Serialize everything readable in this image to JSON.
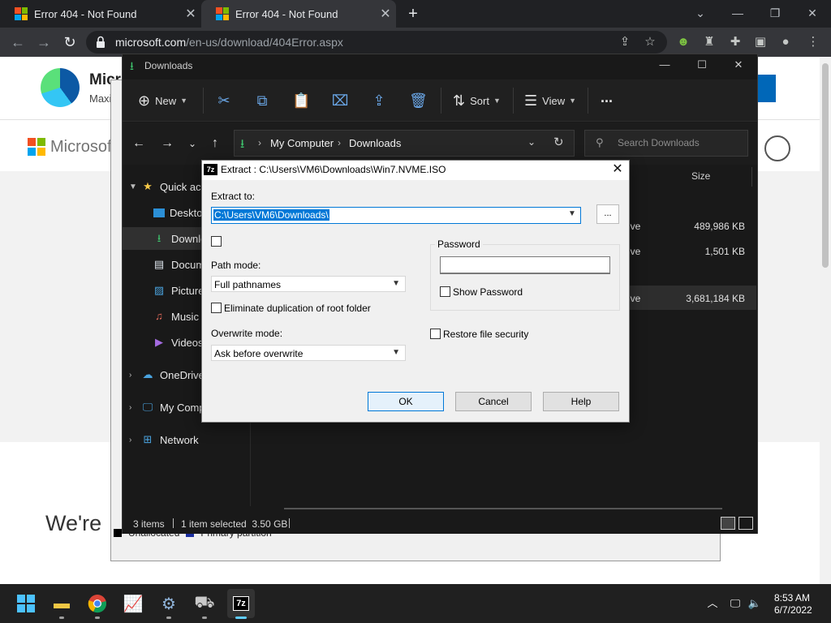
{
  "browser": {
    "tabs": [
      {
        "title": "Error 404 - Not Found",
        "active": false
      },
      {
        "title": "Error 404 - Not Found",
        "active": true
      }
    ],
    "url_host": "microsoft.com",
    "url_path": "/en-us/download/404Error.aspx",
    "colors": {
      "frame": "#202124",
      "toolbar": "#35363a"
    }
  },
  "page": {
    "brand_partial": "Micr",
    "sub_partial": "Maxi",
    "logo_text": "Microsof",
    "heading_partial": "We're"
  },
  "disk_mgmt": {
    "legend_unallocated": "Unallocated",
    "legend_primary": "Primary partition"
  },
  "explorer": {
    "title": "Downloads",
    "toolbar": {
      "new_label": "New",
      "sort_label": "Sort",
      "view_label": "View",
      "more_label": "..."
    },
    "breadcrumb": [
      "My Computer",
      "Downloads"
    ],
    "search_placeholder": "Search Downloads",
    "nav": {
      "quick_access": "Quick access",
      "desktop": "Desktop",
      "downloads": "Downloads",
      "documents": "Documents",
      "pictures": "Pictures",
      "music": "Music",
      "videos": "Videos",
      "onedrive": "OneDrive",
      "my_computer": "My Computer",
      "network": "Network"
    },
    "columns": {
      "size": "Size"
    },
    "files": [
      {
        "type_partial": "ive",
        "size": "489,986 KB",
        "selected": false
      },
      {
        "type_partial": "ive",
        "size": "1,501 KB",
        "selected": false
      },
      {
        "type_partial": "ive",
        "size": "3,681,184 KB",
        "selected": true
      }
    ],
    "status": {
      "count": "3 items",
      "selected": "1 item selected  3.50 GB"
    }
  },
  "dialog": {
    "title": "Extract : C:\\Users\\VM6\\Downloads\\Win7.NVME.ISO",
    "extract_to_label": "Extract to:",
    "extract_to_value": "C:\\Users\\VM6\\Downloads\\",
    "browse_label": "...",
    "path_mode_label": "Path mode:",
    "path_mode_value": "Full pathnames",
    "eliminate_label": "Eliminate duplication of root folder",
    "overwrite_label": "Overwrite mode:",
    "overwrite_value": "Ask before overwrite",
    "password_label": "Password",
    "show_password_label": "Show Password",
    "restore_security_label": "Restore file security",
    "ok_label": "OK",
    "cancel_label": "Cancel",
    "help_label": "Help",
    "icon_text": "7z"
  },
  "taskbar": {
    "time": "8:53 AM",
    "date": "6/7/2022",
    "seven_zip_text": "7z"
  }
}
